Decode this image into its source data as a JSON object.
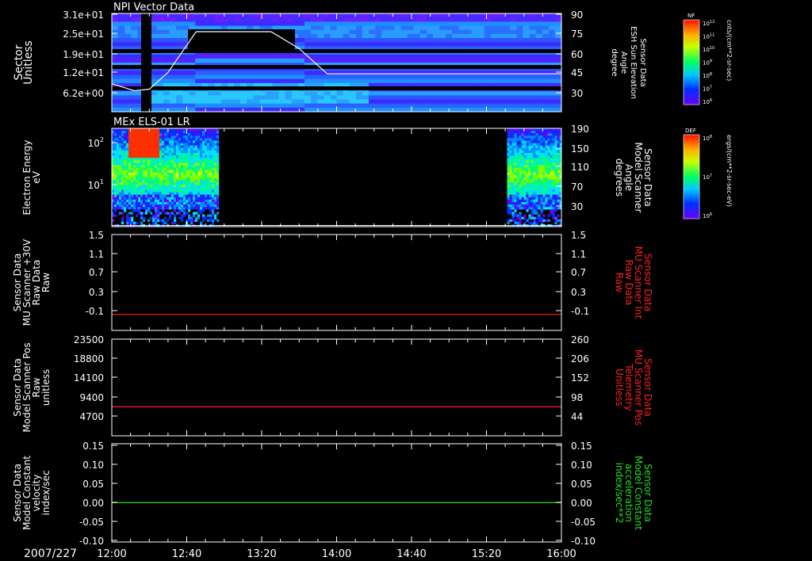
{
  "date_label": "2007/227",
  "time_ticks": [
    "12:00",
    "12:40",
    "13:20",
    "14:00",
    "14:40",
    "15:20",
    "16:00"
  ],
  "panels": [
    {
      "id": "npi",
      "title": "NPI Vector Data",
      "left_axis_title": [
        "Sector",
        "Unitless"
      ],
      "left_ticks": [
        "3.1e+01",
        "2.5e+01",
        "1.9e+01",
        "1.2e+01",
        "6.2e+00"
      ],
      "right_ticks": [
        "90",
        "75",
        "60",
        "45",
        "30"
      ],
      "right_axis_title": [
        "Sensor Data",
        "ESH Sun Elevation",
        "Angle",
        "degree"
      ],
      "right_axis_color": "#ffffff"
    },
    {
      "id": "els",
      "title": "MEx ELS-01 LR",
      "left_axis_title": [
        "Electron Energy",
        "eV"
      ],
      "left_ticks": [
        "10",
        "10"
      ],
      "left_tick_exp": [
        "2",
        "1"
      ],
      "right_ticks": [
        "190",
        "150",
        "110",
        "70",
        "30"
      ],
      "right_axis_title": [
        "Sensor Data",
        "Model Scanner",
        "Angle",
        "degrees"
      ],
      "right_axis_color": "#ffffff"
    },
    {
      "id": "raw30v",
      "title": "",
      "left_axis_title": [
        "Sensor Data",
        "MU Scanner +30V",
        "Raw Data",
        "Raw"
      ],
      "left_ticks": [
        "1.5",
        "1.1",
        "0.7",
        "0.3",
        "-0.1"
      ],
      "right_ticks": [
        "1.5",
        "1.1",
        "0.7",
        "0.3",
        "-0.1"
      ],
      "right_axis_title": [
        "Sensor Data",
        "MU Scanner Int",
        "Raw Data",
        "Raw"
      ],
      "right_axis_color": "#ff2020"
    },
    {
      "id": "pos",
      "title": "",
      "left_axis_title": [
        "Sensor Data",
        "Model Scanner Pos",
        "Raw",
        "unitless"
      ],
      "left_ticks": [
        "23500",
        "18800",
        "14100",
        "9400",
        "4700"
      ],
      "right_ticks": [
        "260",
        "206",
        "152",
        "98",
        "44"
      ],
      "right_axis_title": [
        "Sensor Data",
        "MU Scanner Pos",
        "Telemetry",
        "Unitless"
      ],
      "right_axis_color": "#ff2020"
    },
    {
      "id": "const",
      "title": "",
      "left_axis_title": [
        "Sensor Data",
        "Model Constant",
        "velocity",
        "index/sec"
      ],
      "left_ticks": [
        "0.15",
        "0.10",
        "0.05",
        "0.00",
        "-0.05",
        "-0.10"
      ],
      "right_ticks": [
        "0.15",
        "0.10",
        "0.05",
        "0.00",
        "-0.05",
        "-0.10"
      ],
      "right_axis_title": [
        "Sensor Data",
        "Model Constant",
        "acceleration",
        "index/sec**2"
      ],
      "right_axis_color": "#20e020"
    }
  ],
  "colorbars": [
    {
      "id": "nf",
      "label": "NF",
      "ticks": [
        "10",
        "10",
        "10",
        "10",
        "10",
        "10",
        "10"
      ],
      "tick_exp": [
        "12",
        "11",
        "10",
        "9",
        "8",
        "7",
        "6"
      ],
      "units": "cnts/(cm**2-sr-sec)"
    },
    {
      "id": "def",
      "label": "DEF",
      "ticks": [
        "10",
        "10",
        "10"
      ],
      "tick_exp": [
        "8",
        "7",
        "6"
      ],
      "units": "ergs/(cm**2-sr-sec-eV)"
    }
  ],
  "colors": {
    "background": "#000000",
    "axis": "#ffffff",
    "series_red": "#ff2020",
    "series_green": "#20e020",
    "sun_line": "#ffffff"
  },
  "chart_data": [
    {
      "type": "heatmap",
      "title": "NPI Vector Data",
      "x": "time 12:00–16:00",
      "ylabel": "Sector Unitless",
      "y2label": "Sensor Data ESH Sun Elevation Angle degree",
      "y2lim": [
        20,
        90
      ],
      "overlay_line": {
        "name": "ESH Sun Elevation Angle",
        "points": [
          [
            "12:00",
            40
          ],
          [
            "12:12",
            35
          ],
          [
            "12:20",
            36
          ],
          [
            "12:30",
            48
          ],
          [
            "12:45",
            77
          ],
          [
            "13:25",
            77
          ],
          [
            "13:40",
            65
          ],
          [
            "13:55",
            47
          ],
          [
            "16:00",
            47
          ]
        ]
      }
    },
    {
      "type": "heatmap",
      "title": "MEx ELS-01 LR",
      "ylabel": "Electron Energy eV",
      "y2label": "Sensor Data Model Scanner Angle degrees",
      "y2lim": [
        10,
        190
      ],
      "data_intervals": [
        [
          "12:00",
          "12:57"
        ],
        [
          "15:31",
          "16:00"
        ]
      ],
      "overlay_line": {
        "name": "Model Scanner Angle",
        "value": 12
      }
    },
    {
      "type": "line",
      "ylabel": "Sensor Data MU Scanner +30V Raw Data Raw",
      "ylim": [
        -0.3,
        1.5
      ],
      "series": [
        {
          "name": "MU Scanner Int Raw Data Raw",
          "values": [
            0,
            0
          ],
          "x": [
            "12:00",
            "16:00"
          ]
        }
      ]
    },
    {
      "type": "line",
      "ylabel": "Sensor Data Model Scanner Pos Raw unitless",
      "ylim": [
        0,
        23500
      ],
      "series": [
        {
          "name": "MU Scanner Pos Telemetry Unitless",
          "values": [
            7050,
            7050
          ],
          "x": [
            "12:00",
            "16:00"
          ]
        }
      ]
    },
    {
      "type": "line",
      "ylabel": "Sensor Data Model Constant velocity index/sec",
      "ylim": [
        -0.1,
        0.15
      ],
      "series": [
        {
          "name": "Model Constant acceleration index/sec**2",
          "values": [
            0,
            0
          ],
          "x": [
            "12:00",
            "16:00"
          ]
        }
      ]
    }
  ]
}
